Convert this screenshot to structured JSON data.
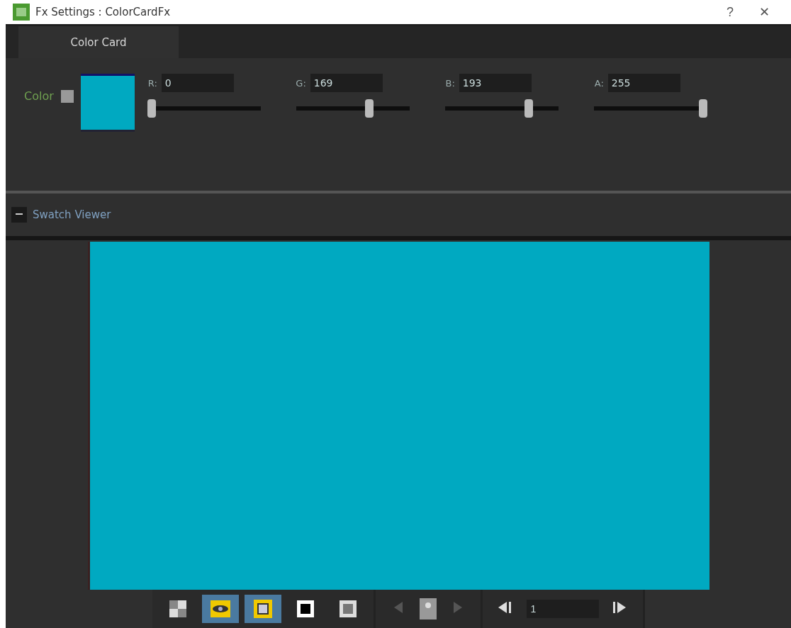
{
  "window": {
    "title": "Fx Settings : ColorCardFx",
    "help": "?",
    "close": "✕"
  },
  "tabs": [
    {
      "label": "Color Card",
      "selected": true
    }
  ],
  "param": {
    "label": "Color",
    "color": "#00a9c1",
    "channels": [
      {
        "name": "R:",
        "value": "0",
        "level": 0
      },
      {
        "name": "G:",
        "value": "169",
        "level": 0.66
      },
      {
        "name": "B:",
        "value": "193",
        "level": 0.76
      },
      {
        "name": "A:",
        "value": "255",
        "level": 1
      }
    ]
  },
  "viewer": {
    "title": "Swatch Viewer",
    "expanded": true
  },
  "toolbar": {
    "tools": [
      {
        "selected": false
      },
      {
        "selected": true
      },
      {
        "selected": true
      },
      {
        "selected": false
      },
      {
        "selected": false
      }
    ],
    "prev_disabled": true,
    "next_disabled": true,
    "frame": "1"
  }
}
